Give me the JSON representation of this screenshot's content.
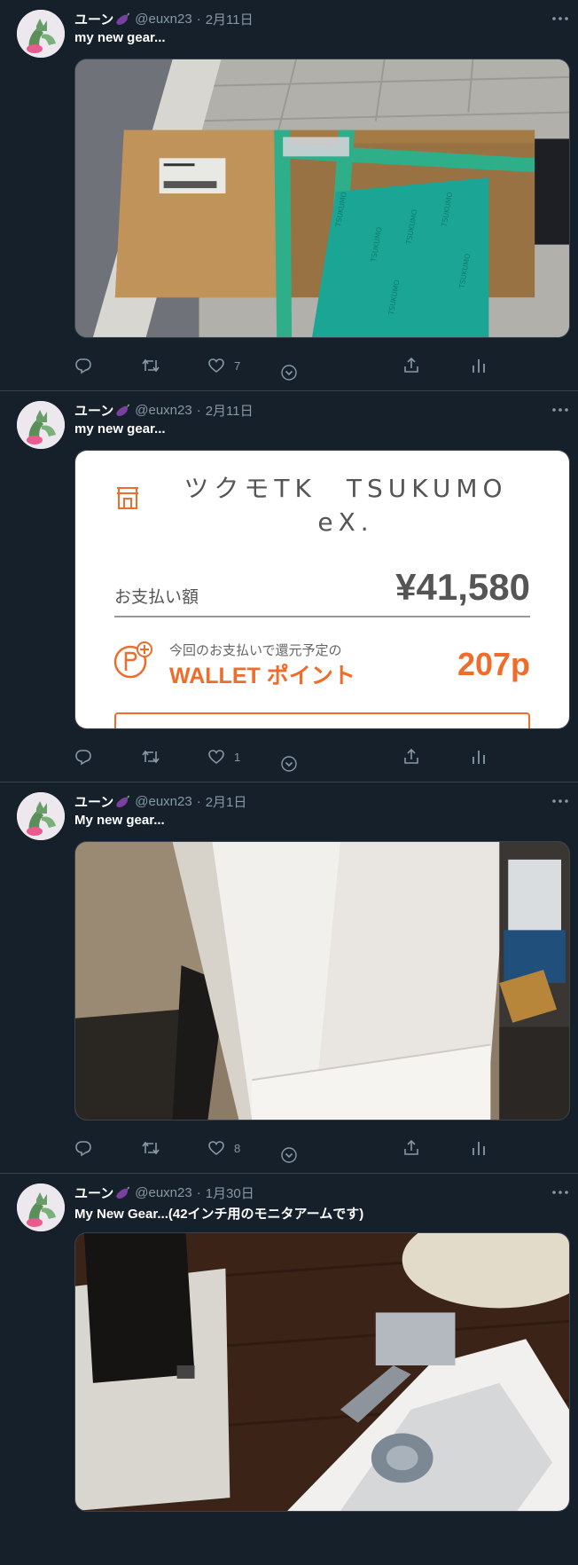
{
  "tweets": [
    {
      "name": "ユーン",
      "name_emoji": "eggplant-icon",
      "handle": "@euxn23",
      "separator": "·",
      "date": "2月11日",
      "text": "my new gear...",
      "media_type": "photo-box",
      "likes": "7"
    },
    {
      "name": "ユーン",
      "name_emoji": "eggplant-icon",
      "handle": "@euxn23",
      "separator": "·",
      "date": "2月11日",
      "text": "my new gear...",
      "media_type": "receipt",
      "likes": "1",
      "receipt": {
        "store": "ツクモTK　TSUKUMO eX.",
        "payment_label": "お支払い額",
        "amount": "¥41,580",
        "points_caption": "今回のお支払いで還元予定の",
        "points_label": "WALLET ポイント",
        "points_value": "207p",
        "accent_color": "#ef6c2a"
      }
    },
    {
      "name": "ユーン",
      "name_emoji": "eggplant-icon",
      "handle": "@euxn23",
      "separator": "·",
      "date": "2月1日",
      "text": "My new gear...",
      "media_type": "photo-fridge",
      "likes": "8"
    },
    {
      "name": "ユーン",
      "name_emoji": "eggplant-icon",
      "handle": "@euxn23",
      "separator": "·",
      "date": "1月30日",
      "text": "My New Gear...(42インチ用のモニタアームです)",
      "media_type": "photo-arm"
    }
  ],
  "colors": {
    "background": "#15202b",
    "border": "#38444d",
    "secondary_text": "#8899a6"
  }
}
